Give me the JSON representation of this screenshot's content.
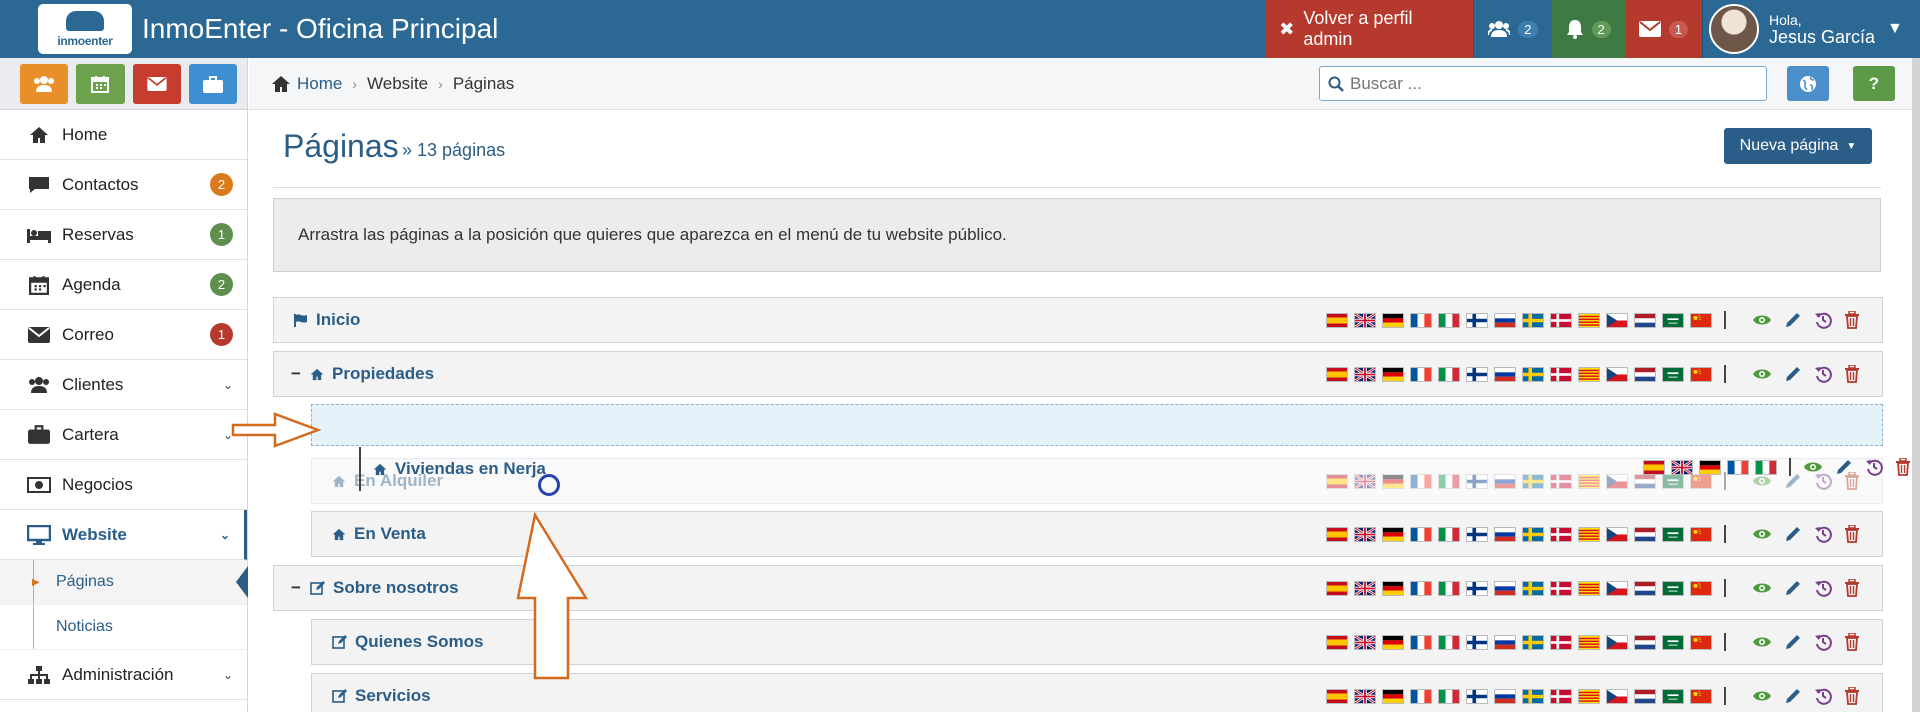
{
  "header": {
    "logo_text": "inmoenter",
    "app_title": "InmoEnter - Oficina Principal",
    "admin_button": "Volver a perfil admin",
    "badges": [
      {
        "icon": "users-icon",
        "count": "2",
        "color": "#2b6994",
        "badge_color": "#3d7fae"
      },
      {
        "icon": "bell-icon",
        "count": "2",
        "color": "#3f7a45",
        "badge_color": "#5f9a56"
      },
      {
        "icon": "envelope-icon",
        "count": "1",
        "color": "#b53a2d",
        "badge_color": "#c65a4e"
      }
    ],
    "user": {
      "greeting": "Hola,",
      "name": "Jesus García"
    }
  },
  "sidebar": {
    "quick_buttons": [
      {
        "icon": "users-icon",
        "color": "#e88f2a"
      },
      {
        "icon": "calendar-icon",
        "color": "#6da34d"
      },
      {
        "icon": "envelope-icon",
        "color": "#c63c2f"
      },
      {
        "icon": "briefcase-icon",
        "color": "#3d8fd1"
      }
    ],
    "items": [
      {
        "label": "Home",
        "icon": "home-icon"
      },
      {
        "label": "Contactos",
        "icon": "comment-icon",
        "count": "2",
        "count_color": "#d97b1a"
      },
      {
        "label": "Reservas",
        "icon": "bed-icon",
        "count": "1",
        "count_color": "#5f8f4f"
      },
      {
        "label": "Agenda",
        "icon": "calendar-icon",
        "count": "2",
        "count_color": "#5f8f4f"
      },
      {
        "label": "Correo",
        "icon": "envelope-icon",
        "count": "1",
        "count_color": "#b53a2d"
      },
      {
        "label": "Clientes",
        "icon": "users-icon"
      },
      {
        "label": "Cartera",
        "icon": "briefcase-icon"
      },
      {
        "label": "Negocios",
        "icon": "money-icon"
      },
      {
        "label": "Website",
        "icon": "desktop-icon"
      },
      {
        "label": "Administración",
        "icon": "sitemap-icon"
      }
    ],
    "sub_items": [
      {
        "label": "Páginas"
      },
      {
        "label": "Noticias"
      }
    ]
  },
  "breadcrumb": {
    "home": "Home",
    "website": "Website",
    "current": "Páginas",
    "search_placeholder": "Buscar ..."
  },
  "main": {
    "title": "Páginas",
    "count": "» 13 páginas",
    "new_button": "Nueva página",
    "info": "Arrastra las páginas a la posición que quieres que aparezca en el menú de tu website público.",
    "pages": [
      {
        "label": "Inicio",
        "icon": "flag-icon"
      },
      {
        "label": "Propiedades",
        "icon": "home-icon",
        "collapse": "−"
      },
      {
        "label": "En Alquiler",
        "icon": "home-icon"
      },
      {
        "label": "En Venta",
        "icon": "home-icon"
      },
      {
        "label": "Sobre nosotros",
        "icon": "edit-icon",
        "collapse": "−"
      },
      {
        "label": "Quienes Somos",
        "icon": "edit-icon"
      },
      {
        "label": "Servicios",
        "icon": "edit-icon"
      }
    ],
    "dragging": "Viviendas en Nerja",
    "flags": [
      "es",
      "gb",
      "de",
      "fr",
      "it",
      "fi",
      "ru",
      "se",
      "dk",
      "ca",
      "cz",
      "nl",
      "sa",
      "cn"
    ]
  }
}
